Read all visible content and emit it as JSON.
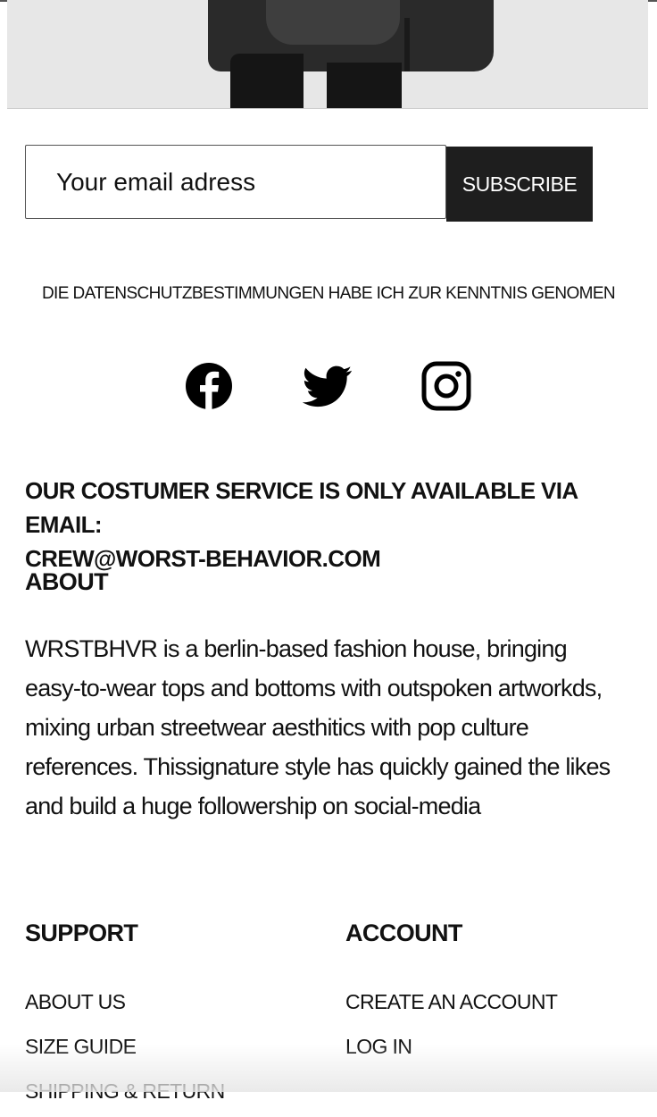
{
  "newsletter": {
    "email_placeholder": "Your email adress",
    "subscribe_label": "SUBSCRIBE"
  },
  "privacy_notice": "DIE DATENSCHUTZBESTIMMUNGEN HABE ICH ZUR KENNTNIS GENOMEN",
  "social": {
    "icons": [
      "facebook-icon",
      "twitter-icon",
      "instagram-icon"
    ]
  },
  "customer_service": {
    "line1": "OUR COSTUMER SERVICE IS ONLY AVAILABLE VIA EMAIL:",
    "email": "CREW@WORST-BEHAVIOR.COM"
  },
  "about": {
    "heading": "ABOUT",
    "text": "WRSTBHVR is a berlin-based fashion house, bringing easy-to-wear tops and bottoms with outspoken artworkds, mixing urban streetwear aesthitics with pop culture references. Thissignature style has quickly gained the likes and build a huge followership on social-media"
  },
  "footer": {
    "support": {
      "heading": "SUPPORT",
      "links": [
        "ABOUT US",
        "SIZE GUIDE",
        "SHIPPING & RETURN"
      ]
    },
    "account": {
      "heading": "ACCOUNT",
      "links": [
        "CREATE AN ACCOUNT",
        "LOG IN"
      ]
    }
  },
  "colors": {
    "text": "#111111",
    "button_bg": "#1e1e1e",
    "button_text": "#ffffff",
    "hero_bg": "#e7e7e7"
  }
}
